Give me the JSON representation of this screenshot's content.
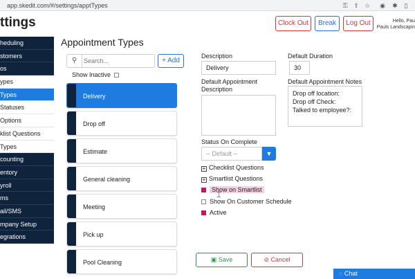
{
  "browser": {
    "url": "app.skedit.com/#/settings/apptTypes"
  },
  "header": {
    "title": "ttings",
    "clock_out": "Clock Out",
    "break": "Break",
    "log_out": "Log Out",
    "hello_line1": "Hello, Pau",
    "hello_line2": "Pauls Landscapin"
  },
  "sidebar": {
    "items": [
      {
        "label": "heduling"
      },
      {
        "label": "stomers"
      },
      {
        "label": "os"
      },
      {
        "label": "ypes"
      },
      {
        "label": "Types"
      },
      {
        "label": "Statuses"
      },
      {
        "label": "Options"
      },
      {
        "label": "klist Questions"
      },
      {
        "label": "Types"
      },
      {
        "label": "counting"
      },
      {
        "label": "entory"
      },
      {
        "label": "yroll"
      },
      {
        "label": "ms"
      },
      {
        "label": "ail/SMS"
      },
      {
        "label": "mpany Setup"
      },
      {
        "label": "egrations"
      }
    ]
  },
  "main": {
    "section_title": "Appointment Types",
    "search_placeholder": "Search...",
    "add_label": "+ Add",
    "show_inactive": "Show Inactive",
    "types": [
      {
        "label": "Delivery"
      },
      {
        "label": "Drop off"
      },
      {
        "label": "Estimate"
      },
      {
        "label": "General cleaning"
      },
      {
        "label": "Meeting"
      },
      {
        "label": "Pick up"
      },
      {
        "label": "Pool Cleaning"
      }
    ]
  },
  "form": {
    "description_label": "Description",
    "description_value": "Delivery",
    "duration_label": "Default Duration",
    "duration_value": "30",
    "appt_desc_label": "Default Appointment Description",
    "notes_label": "Default Appointment Notes",
    "notes_lines": [
      "Drop off location:",
      "Drop off Check:",
      "Talked to employee?:"
    ],
    "status_label": "Status On Complete",
    "status_placeholder": "-- Default --",
    "checklist_questions": "Checklist Questions",
    "smartlist_questions": "Smartlist Questions",
    "show_on_smartlist": "Show on Smartlist",
    "show_on_customer_schedule": "Show On Customer Schedule",
    "active": "Active",
    "save": "Save",
    "cancel": "Cancel"
  },
  "chat": {
    "label": "Chat"
  },
  "colors": {
    "accent": "#1e7be0",
    "sidebar_dark": "#10233c",
    "danger": "#d9333f",
    "success": "#2a9d4a",
    "check": "#c2185b"
  },
  "checkbox_state": {
    "show_inactive": false,
    "show_on_smartlist": true,
    "show_on_customer_schedule": false,
    "active": true
  }
}
